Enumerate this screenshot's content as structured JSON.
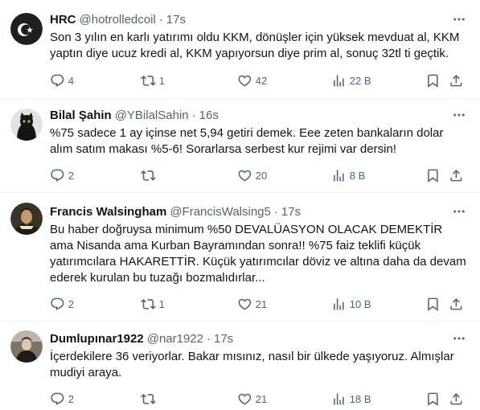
{
  "tweets": [
    {
      "name": "HRC",
      "handle": "@hotrolledcoil",
      "dot": "·",
      "time": "17s",
      "text": "Son 3 yılın en karlı yatırımı oldu KKM, dönüşler için yüksek mevduat al, KKM yaptın diye ucuz kredi al, KKM yapıyorsun diye prim al, sonuç 32tl ti geçtik.",
      "replies": "4",
      "retweets": "1",
      "likes": "42",
      "views": "22 B",
      "avatar_color": "#1d1f22"
    },
    {
      "name": "Bilal Şahin",
      "handle": "@YBilalSahin",
      "dot": "·",
      "time": "16s",
      "text": "%75 sadece 1 ay içinse net 5,94 getiri demek. Eee zeten bankaların dolar alım satım makası %5-6! Sorarlarsa serbest kur rejimi var dersin!",
      "replies": "2",
      "retweets": "",
      "likes": "20",
      "views": "8 B",
      "avatar_color": "#1a1a1a"
    },
    {
      "name": "Francis Walsingham",
      "handle": "@FrancisWalsing5",
      "dot": "·",
      "time": "17s",
      "text": "Bu haber doğruysa minimum %50 DEVALÜASYON OLACAK DEMEKTİR ama Nisanda ama Kurban Bayramından sonra!! %75 faiz teklifi küçük yatırımcılara HAKARETTİR. Küçük yatırımcılar döviz ve altına daha da devam ederek kurulan bu tuzağı bozmalıdırlar...",
      "replies": "2",
      "retweets": "1",
      "likes": "21",
      "views": "10 B",
      "avatar_color": "#6b5a44"
    },
    {
      "name": "Dumlupınar1922",
      "handle": "@nar1922",
      "dot": "·",
      "time": "17s",
      "text": "İçerdekilere 36 veriyorlar. Bakar mısınız, nasıl bir ülkede yaşıyoruz. Almışlar mudiyi araya.",
      "replies": "2",
      "retweets": "",
      "likes": "21",
      "views": "18 B",
      "avatar_color": "#2a2622"
    }
  ],
  "icons": {
    "more": "more-icon",
    "reply": "reply-icon",
    "retweet": "retweet-icon",
    "like": "like-icon",
    "views": "views-icon",
    "bookmark": "bookmark-icon",
    "share": "share-icon"
  },
  "colors": {
    "text": "#0f1419",
    "secondary": "#536471",
    "divider": "#eff3f4"
  }
}
